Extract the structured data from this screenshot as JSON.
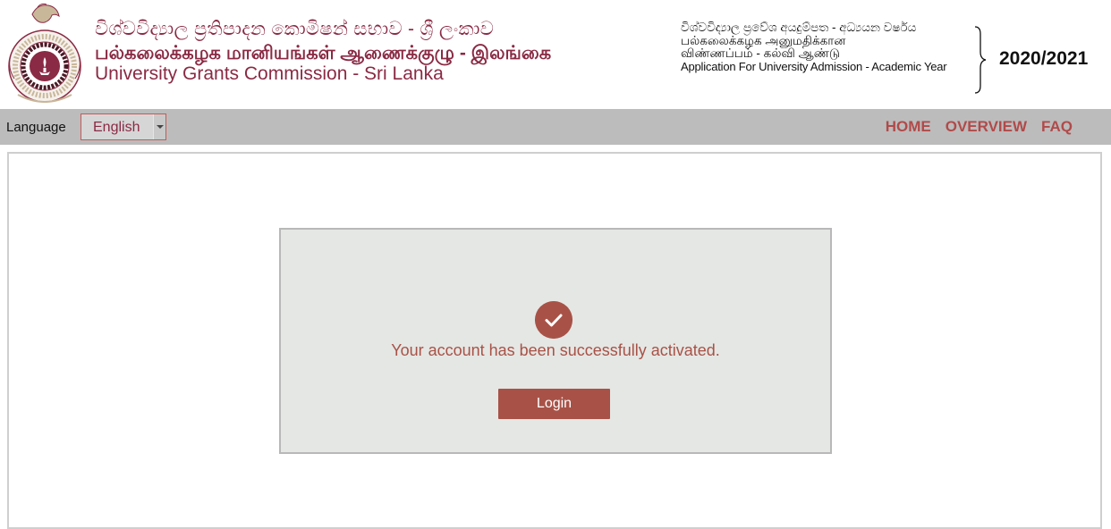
{
  "header": {
    "title_sinhala": "විශ්වවිද්‍යාල ප්‍රතිපාදන කොමිෂන් සභාව - ශ්‍රී ලංකාව",
    "title_tamil": "பல்கலைக்கழக மானியங்கள் ஆணைக்குழு - இலங்கை",
    "title_english": "University Grants Commission - Sri Lanka",
    "application_sinhala": "විශ්වවිද්‍යාල ප්‍රවේශ අයදුම්පත - අධ්‍යයන වර්ෂය",
    "application_tamil_1": "பல்கலைக்கழக அனுமதிக்கான",
    "application_tamil_2": "விண்ணப்பம் - கல்வி ஆண்டு",
    "application_english": "Application For University Admission - Academic Year",
    "academic_year": "2020/2021"
  },
  "navbar": {
    "language_label": "Language",
    "language_selected": "English",
    "links": [
      "HOME",
      "OVERVIEW",
      "FAQ"
    ]
  },
  "main": {
    "message": "Your account has been successfully activated.",
    "login_label": "Login"
  },
  "colors": {
    "brand": "#8a2a44",
    "accent": "#a85247",
    "nav_link": "#b14a4a",
    "navbar_bg": "#bcbcbc",
    "card_bg": "#e5e7e4"
  },
  "icons": {
    "logo": "ugc-emblem-logo",
    "success": "check-circle-icon",
    "dropdown": "caret-down-icon"
  }
}
